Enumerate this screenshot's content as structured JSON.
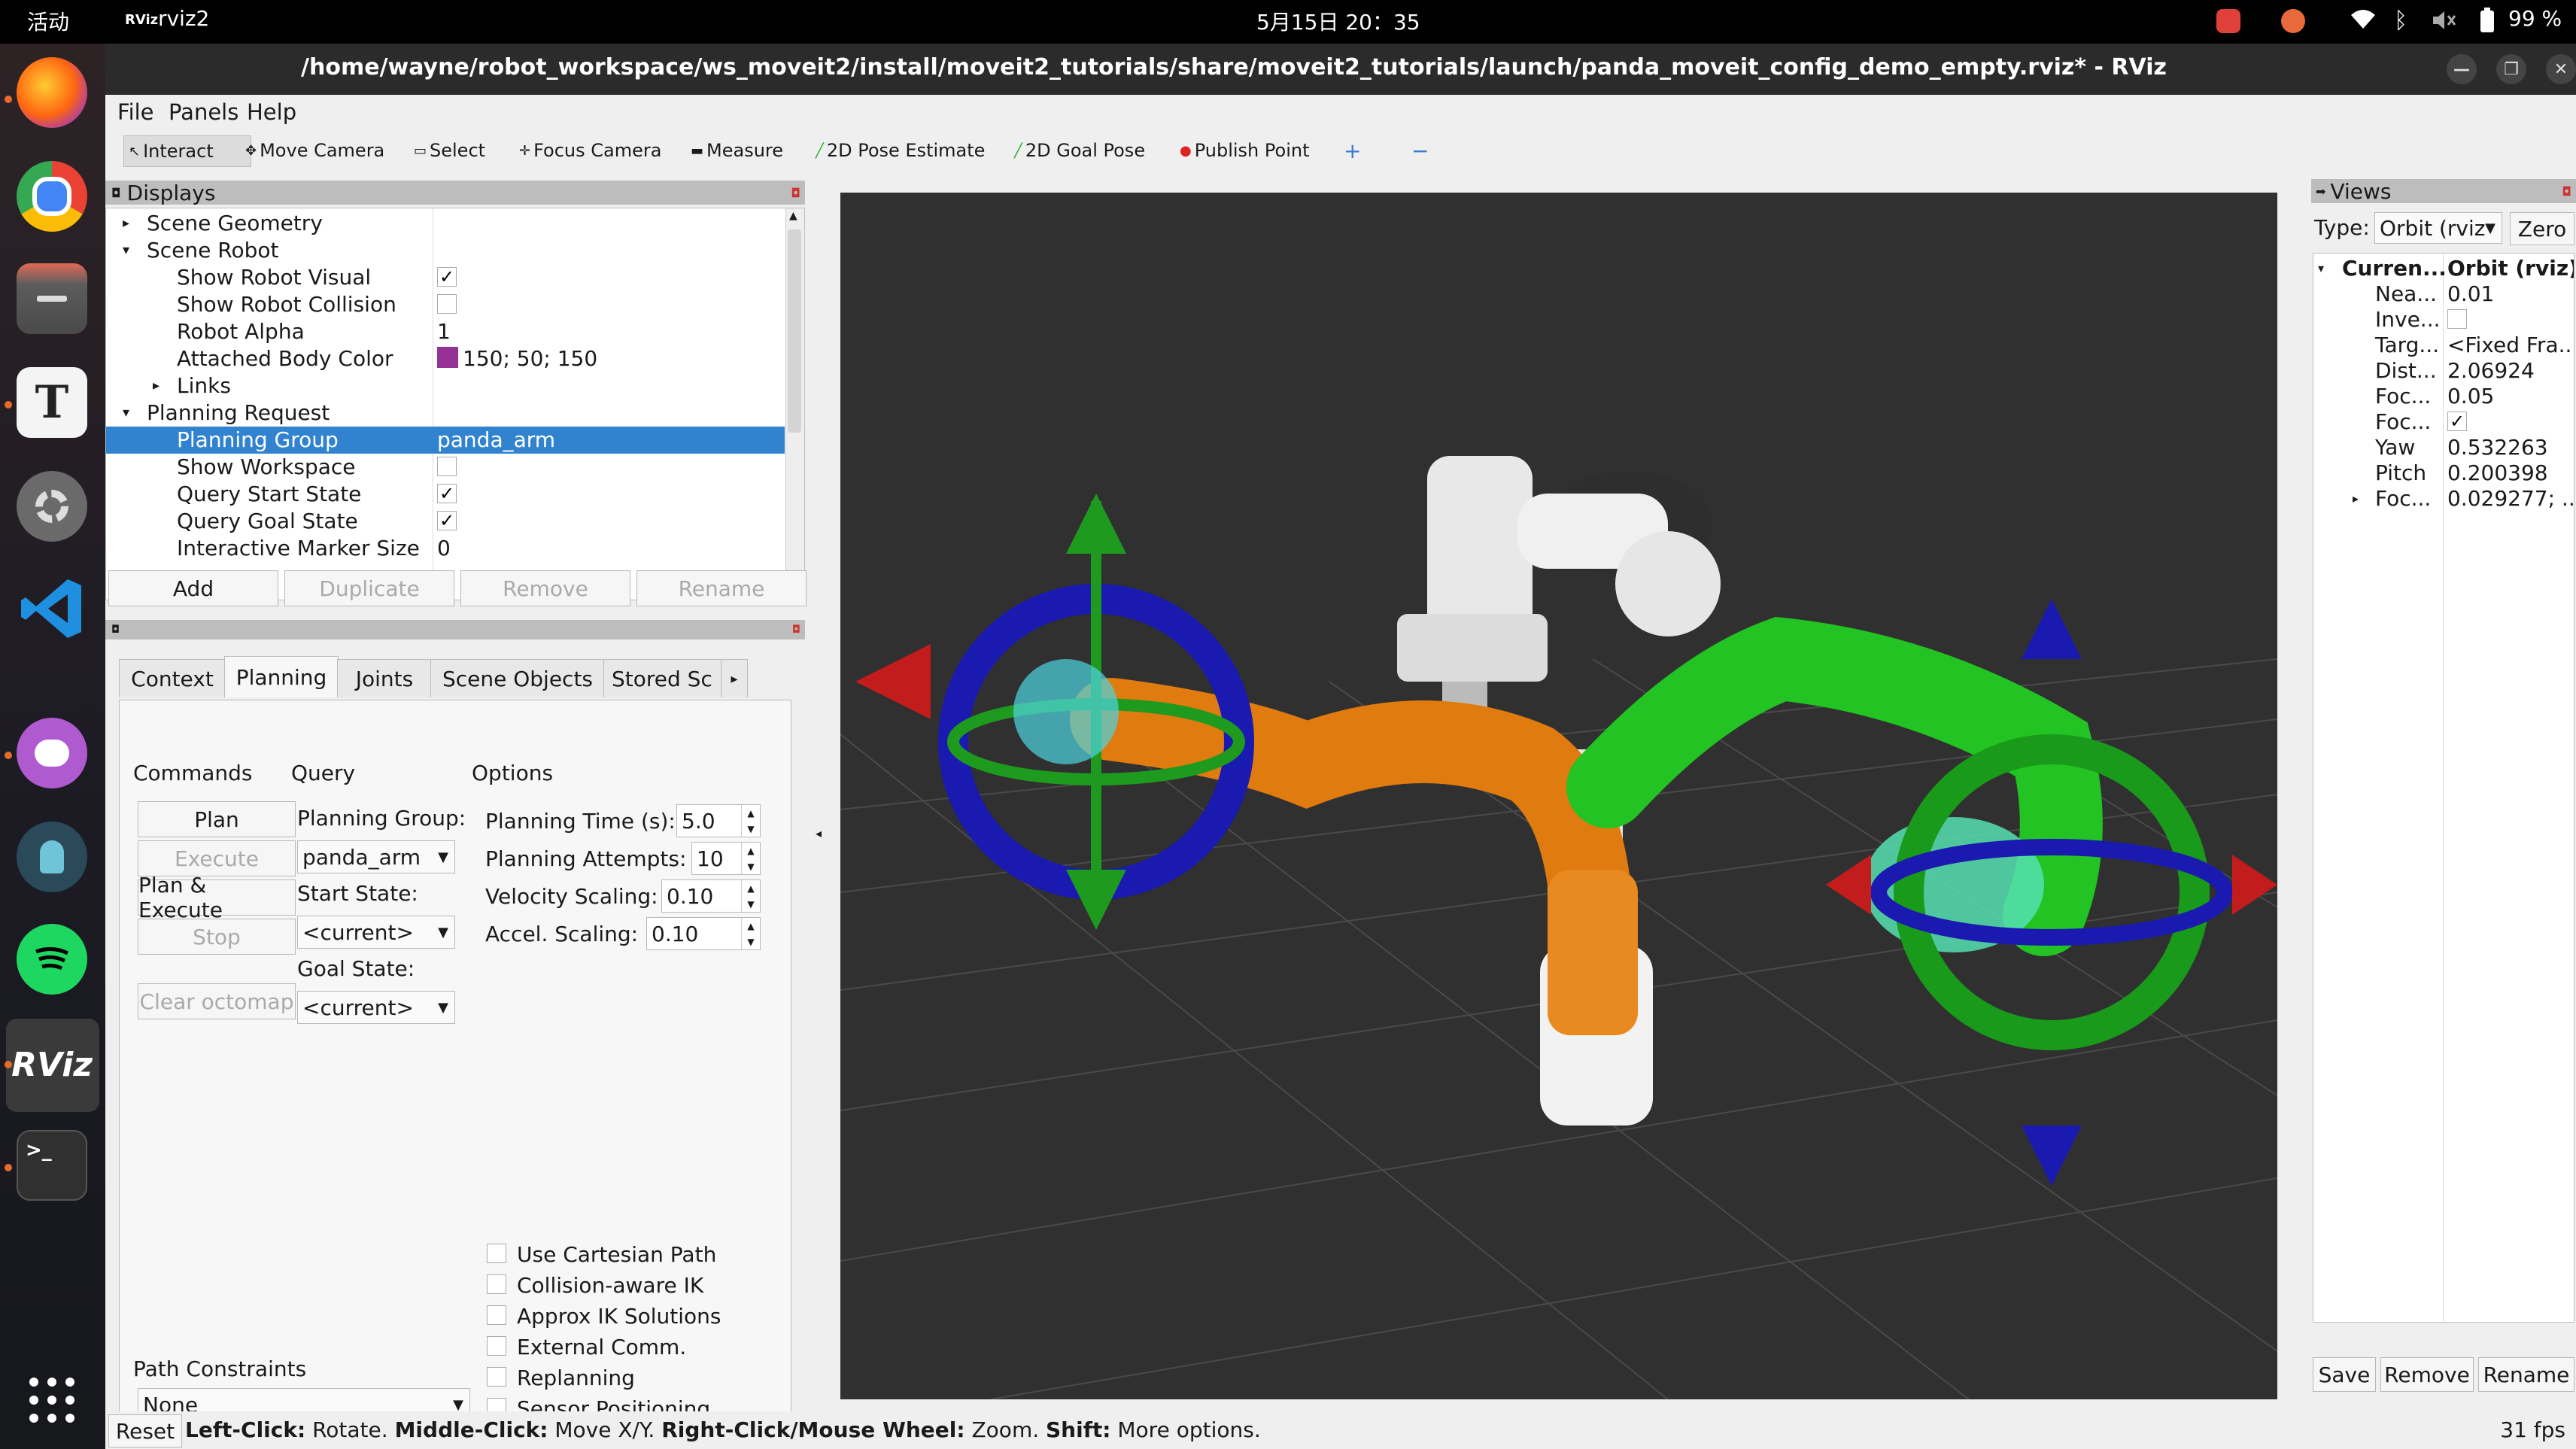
{
  "topbar": {
    "activities": "活动",
    "app_logo": "RViz",
    "app_name": "rviz2",
    "clock": "5月15日  20：35",
    "battery": "99 %"
  },
  "window": {
    "title": "/home/wayne/robot_workspace/ws_moveit2/install/moveit2_tutorials/share/moveit2_tutorials/launch/panda_moveit_config_demo_empty.rviz* - RViz"
  },
  "menubar": {
    "items": [
      "File",
      "Panels",
      "Help"
    ]
  },
  "toolbar": {
    "tools": [
      "Interact",
      "Move Camera",
      "Select",
      "Focus Camera",
      "Measure",
      "2D Pose Estimate",
      "2D Goal Pose",
      "Publish Point"
    ]
  },
  "displays": {
    "title": "Displays",
    "rows": [
      {
        "label": "Scene Geometry",
        "value": ""
      },
      {
        "label": "Scene Robot",
        "value": ""
      },
      {
        "label": "Show Robot Visual",
        "value": "✓"
      },
      {
        "label": "Show Robot Collision",
        "value": ""
      },
      {
        "label": "Robot Alpha",
        "value": "1"
      },
      {
        "label": "Attached Body Color",
        "value": "150; 50; 150"
      },
      {
        "label": "Links",
        "value": ""
      },
      {
        "label": "Planning Request",
        "value": ""
      },
      {
        "label": "Planning Group",
        "value": "panda_arm"
      },
      {
        "label": "Show Workspace",
        "value": ""
      },
      {
        "label": "Query Start State",
        "value": "✓"
      },
      {
        "label": "Query Goal State",
        "value": "✓"
      },
      {
        "label": "Interactive Marker Size",
        "value": "0"
      }
    ],
    "attached_color": "#963296",
    "buttons": {
      "add": "Add",
      "duplicate": "Duplicate",
      "remove": "Remove",
      "rename": "Rename"
    }
  },
  "motion": {
    "tabs": [
      "Context",
      "Planning",
      "Joints",
      "Scene Objects",
      "Stored Sc"
    ],
    "commands_label": "Commands",
    "query_label": "Query",
    "options_label": "Options",
    "buttons": {
      "plan": "Plan",
      "execute": "Execute",
      "plan_execute": "Plan & Execute",
      "stop": "Stop",
      "clear_octomap": "Clear octomap"
    },
    "planning_group_label": "Planning Group:",
    "planning_group": "panda_arm",
    "start_state_label": "Start State:",
    "start_state": "<current>",
    "goal_state_label": "Goal State:",
    "goal_state": "<current>",
    "planning_time_label": "Planning Time (s):",
    "planning_time": "5.0",
    "planning_attempts_label": "Planning Attempts:",
    "planning_attempts": "10",
    "velocity_label": "Velocity Scaling:",
    "velocity": "0.10",
    "accel_label": "Accel. Scaling:",
    "accel": "0.10",
    "checkboxes": [
      "Use Cartesian Path",
      "Collision-aware IK",
      "Approx IK Solutions",
      "External Comm.",
      "Replanning",
      "Sensor Positioning"
    ],
    "path_constraints_label": "Path Constraints",
    "path_constraints": "None"
  },
  "views": {
    "title": "Views",
    "type_label": "Type:",
    "type_value": "Orbit (rviz",
    "zero": "Zero",
    "current_label": "Curren...",
    "current_value": "Orbit (rviz)",
    "rows": [
      {
        "k": "Nea...",
        "v": "0.01"
      },
      {
        "k": "Inve...",
        "v": ""
      },
      {
        "k": "Targ...",
        "v": "<Fixed Fra..."
      },
      {
        "k": "Dist...",
        "v": "2.06924"
      },
      {
        "k": "Foc...",
        "v": "0.05"
      },
      {
        "k": "Foc...",
        "v": "✓"
      },
      {
        "k": "Yaw",
        "v": "0.532263"
      },
      {
        "k": "Pitch",
        "v": "0.200398"
      },
      {
        "k": "Foc...",
        "v": "0.029277; ..."
      }
    ],
    "buttons": {
      "save": "Save",
      "remove": "Remove",
      "rename": "Rename"
    }
  },
  "status": {
    "reset": "Reset",
    "k1": "Left-Click:",
    "v1": " Rotate. ",
    "k2": "Middle-Click:",
    "v2": " Move X/Y. ",
    "k3": "Right-Click/Mouse Wheel:",
    "v3": " Zoom. ",
    "k4": "Shift:",
    "v4": " More options.",
    "fps": "31 fps"
  },
  "colors": {
    "selection": "#3183d0",
    "start_state": "#ff8c00",
    "goal_state": "#00c800",
    "viewport_bg": "#303030"
  }
}
